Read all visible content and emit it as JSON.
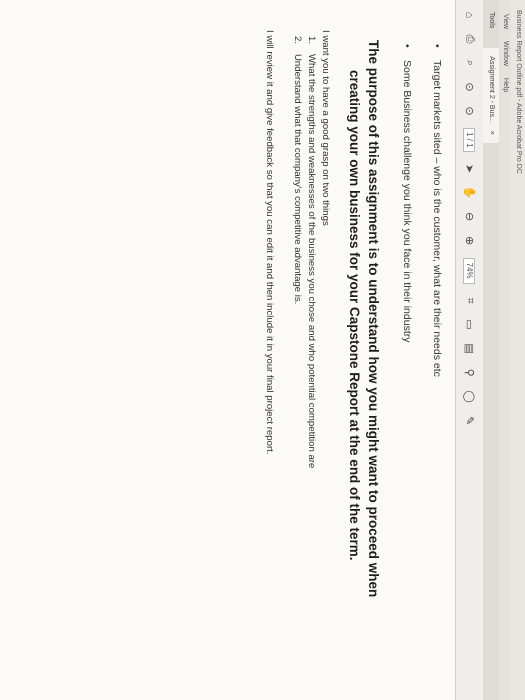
{
  "window": {
    "title": "Business Report Outline.pdf - Adobe Acrobat Pro DC",
    "menu": [
      "View",
      "Window",
      "Help"
    ],
    "tabs": [
      "Tools",
      "Assignment 2 - Bus...",
      "×"
    ]
  },
  "toolbar": {
    "page_indicator": "1 / 1",
    "zoom": "74%",
    "icons": [
      "home-icon",
      "print-icon",
      "search-icon",
      "prev-page-icon",
      "next-page-icon",
      "cursor-icon",
      "hand-icon",
      "zoom-out-icon",
      "zoom-in-icon",
      "fit-icon",
      "comment-icon",
      "highlight-icon",
      "pen-icon"
    ]
  },
  "document": {
    "bullets": [
      "Target markets sited – who is the customer, what are their needs etc",
      "Some Business challenge you think you face in their industry"
    ],
    "heading_line1": "The purpose of this assignment is to understand how you might want to proceed when",
    "heading_line2": "creating your own business for your Capstone Report at the end of the term.",
    "intro": "I want you to have a good grasp on two things",
    "items": [
      {
        "n": "1.",
        "text": "What the strengths and weaknesses of the business you chose and who potential competition are"
      },
      {
        "n": "2.",
        "text": "Understand what that company's competitive advantage is."
      }
    ],
    "closing": "I will review it and give feedback so that you can edit it and then include it in your final project report."
  },
  "colors": {
    "accent": "#3f6fa8",
    "page": "#fbfaf7",
    "chrome": "#efeeea"
  }
}
